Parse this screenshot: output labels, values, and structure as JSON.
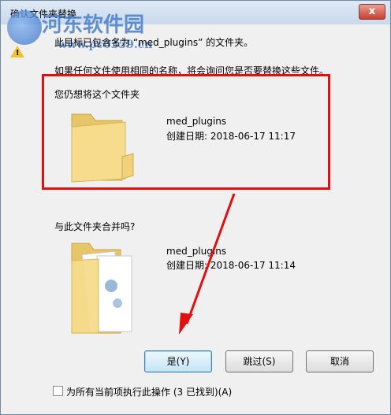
{
  "window": {
    "title": "确认文件夹替换",
    "close_label": "x"
  },
  "watermark": {
    "brand": "河东软件园",
    "url": "www.pc0359.cn"
  },
  "message": {
    "line1": "此目标已包含名为 “med_plugins” 的文件夹。",
    "line2": "如果任何文件使用相同的名称，将会询问您是否要替换这些文件。"
  },
  "existing": {
    "heading": "您仍想将这个文件夹",
    "name": "med_plugins",
    "date": "创建日期: 2018-06-17 11:17"
  },
  "incoming": {
    "heading": "与此文件夹合并吗?",
    "name": "med_plugins",
    "date": "创建日期: 2018-06-17 11:14"
  },
  "buttons": {
    "yes": "是(Y)",
    "skip": "跳过(S)",
    "cancel": "取消"
  },
  "checkbox": {
    "label": "为所有当前项执行此操作 (3 已找到)(A)",
    "checked": false
  },
  "colors": {
    "highlight_box": "#e01010",
    "arrow": "#e01010"
  }
}
